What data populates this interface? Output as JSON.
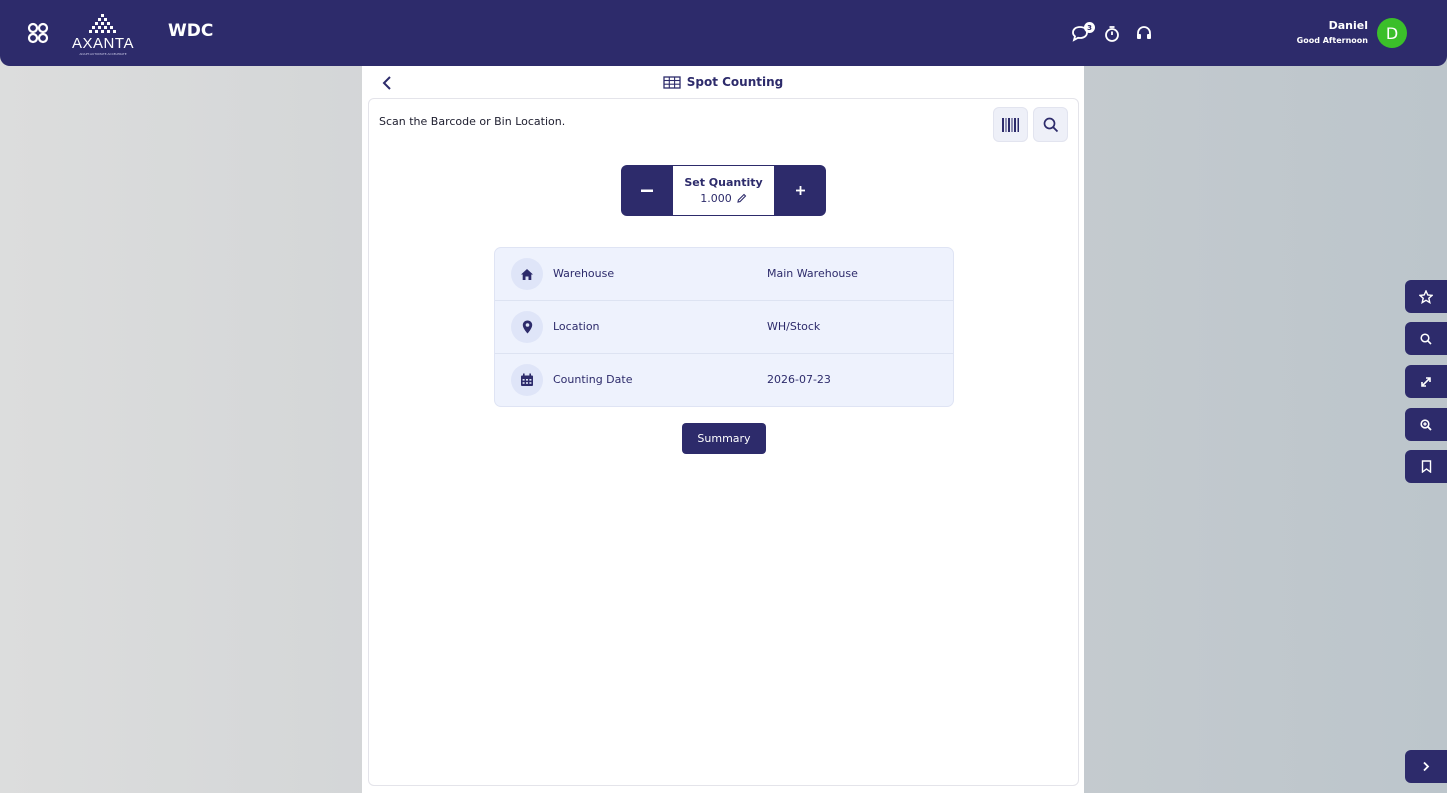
{
  "header": {
    "app_title": "WDC",
    "logo_text": "AXANTA",
    "logo_tagline": "ADAPT.AUTOMATE.ACCELERATE",
    "chat_badge": "3",
    "user_name": "Daniel",
    "greeting": "Good Afternoon",
    "avatar_initial": "D",
    "icons": [
      "apps-grid-icon",
      "chat-icon",
      "stopwatch-icon",
      "headset-icon"
    ]
  },
  "page": {
    "title": "Spot Counting",
    "instruction": "Scan the Barcode or Bin Location."
  },
  "quantity": {
    "label": "Set Quantity",
    "value": "1.000"
  },
  "info_rows": [
    {
      "label": "Warehouse",
      "value": "Main Warehouse",
      "icon": "home-icon"
    },
    {
      "label": "Location",
      "value": "WH/Stock",
      "icon": "map-pin-icon"
    },
    {
      "label": "Counting Date",
      "value": "2026-07-23",
      "icon": "calendar-icon"
    }
  ],
  "summary_label": "Summary",
  "side_toolbar": [
    "star-icon",
    "search-icon",
    "expand-icon",
    "zoom-in-icon",
    "bookmark-icon",
    "chevron-right-icon"
  ],
  "colors": {
    "primary": "#2d2b6b",
    "avatar": "#3bbf2a",
    "info_bg": "#eef2fd"
  }
}
